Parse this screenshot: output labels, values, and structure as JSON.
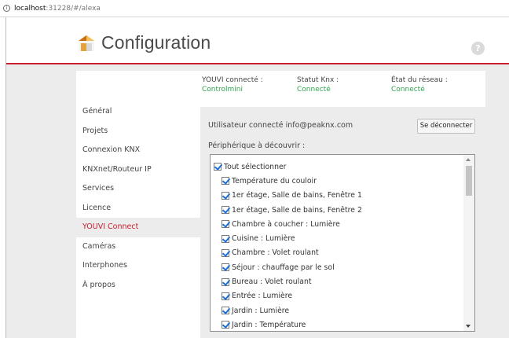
{
  "browser": {
    "url_host": "localhost",
    "url_rest": ":31228/#/alexa",
    "info_icon": "info-icon"
  },
  "header": {
    "title": "Configuration",
    "logo_icon": "house-logo-icon",
    "help_icon": "question-icon",
    "help_glyph": "?",
    "accent_color": "#c8202e"
  },
  "status": {
    "youvi": {
      "label": "YOUVI connecté :",
      "value": "Controlmini"
    },
    "knx": {
      "label": "Statut Knx :",
      "value": "Connecté"
    },
    "network": {
      "label": "État du réseau :",
      "value": "Connecté"
    },
    "value_color": "#2ea44f"
  },
  "sidebar": {
    "items": [
      {
        "label": "Général",
        "active": false
      },
      {
        "label": "Projets",
        "active": false
      },
      {
        "label": "Connexion KNX",
        "active": false
      },
      {
        "label": "KNXnet/Routeur IP",
        "active": false
      },
      {
        "label": "Services",
        "active": false
      },
      {
        "label": "Licence",
        "active": false
      },
      {
        "label": "YOUVI Connect",
        "active": true
      },
      {
        "label": "Caméras",
        "active": false
      },
      {
        "label": "Interphones",
        "active": false
      },
      {
        "label": "À propos",
        "active": false
      }
    ]
  },
  "main": {
    "user_label": "Utilisateur connecté",
    "user_email": "info@peaknx.com",
    "logout_label": "Se déconnecter",
    "discover_label": "Périphérique à découvrir :",
    "select_all_label": "Tout sélectionner",
    "devices": [
      "Température du couloir",
      "1er étage, Salle de bains, Fenêtre 1",
      "1er étage, Salle de bains, Fenêtre 2",
      "Chambre à coucher : Lumière",
      "Cuisine : Lumière",
      "Chambre : Volet roulant",
      "Séjour : chauffage par le sol",
      "Bureau : Volet roulant",
      "Entrée : Lumière",
      "Jardin : Lumière",
      "Jardin : Température"
    ]
  }
}
